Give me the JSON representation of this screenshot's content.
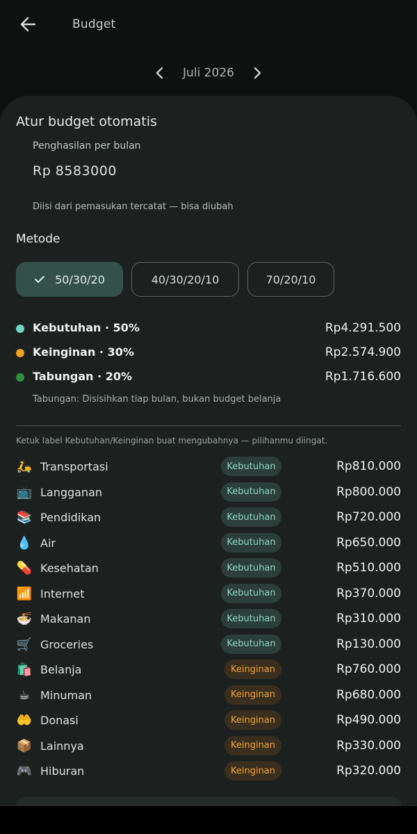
{
  "header": {
    "title": "Budget"
  },
  "month": {
    "label": "Juli 2026"
  },
  "auto_budget": {
    "title": "Atur budget otomatis",
    "income_label": "Penghasilan per bulan",
    "income_value": "Rp 8583000",
    "income_hint": "Diisi dari pemasukan tercatat — bisa diubah"
  },
  "method": {
    "title": "Metode",
    "options": [
      "50/30/20",
      "40/30/20/10",
      "70/20/10"
    ],
    "selected": "50/30/20"
  },
  "allocations": [
    {
      "label": "Kebutuhan · 50%",
      "amount": "Rp4.291.500",
      "color": "#6fd6c0"
    },
    {
      "label": "Keinginan · 30%",
      "amount": "Rp2.574.900",
      "color": "#f0a21b"
    },
    {
      "label": "Tabungan · 20%",
      "amount": "Rp1.716.600",
      "color": "#2f8f3a"
    }
  ],
  "tabungan_note": "Tabungan: Disisihkan tiap bulan, bukan budget belanja",
  "tip": "Ketuk label Kebutuhan/Keinginan buat mengubahnya — pilihanmu diingat.",
  "categories": [
    {
      "emoji": "🛵",
      "icon": "scooter-icon",
      "name": "Transportasi",
      "type": "Kebutuhan",
      "amount": "Rp810.000"
    },
    {
      "emoji": "📺",
      "icon": "tv-icon",
      "name": "Langganan",
      "type": "Kebutuhan",
      "amount": "Rp800.000"
    },
    {
      "emoji": "📚",
      "icon": "books-icon",
      "name": "Pendidikan",
      "type": "Kebutuhan",
      "amount": "Rp720.000"
    },
    {
      "emoji": "💧",
      "icon": "droplet-icon",
      "name": "Air",
      "type": "Kebutuhan",
      "amount": "Rp650.000"
    },
    {
      "emoji": "💊",
      "icon": "pill-icon",
      "name": "Kesehatan",
      "type": "Kebutuhan",
      "amount": "Rp510.000"
    },
    {
      "emoji": "📶",
      "icon": "signal-icon",
      "name": "Internet",
      "type": "Kebutuhan",
      "amount": "Rp370.000"
    },
    {
      "emoji": "🍜",
      "icon": "noodle-bowl-icon",
      "name": "Makanan",
      "type": "Kebutuhan",
      "amount": "Rp310.000"
    },
    {
      "emoji": "🛒",
      "icon": "cart-icon",
      "name": "Groceries",
      "type": "Kebutuhan",
      "amount": "Rp130.000"
    },
    {
      "emoji": "🛍️",
      "icon": "shopping-bags-icon",
      "name": "Belanja",
      "type": "Keinginan",
      "amount": "Rp760.000"
    },
    {
      "emoji": "☕",
      "icon": "coffee-icon",
      "name": "Minuman",
      "type": "Keinginan",
      "amount": "Rp680.000"
    },
    {
      "emoji": "🤲",
      "icon": "palms-up-icon",
      "name": "Donasi",
      "type": "Keinginan",
      "amount": "Rp490.000"
    },
    {
      "emoji": "📦",
      "icon": "package-icon",
      "name": "Lainnya",
      "type": "Keinginan",
      "amount": "Rp330.000"
    },
    {
      "emoji": "🎮",
      "icon": "gamepad-icon",
      "name": "Hiburan",
      "type": "Keinginan",
      "amount": "Rp320.000"
    }
  ]
}
